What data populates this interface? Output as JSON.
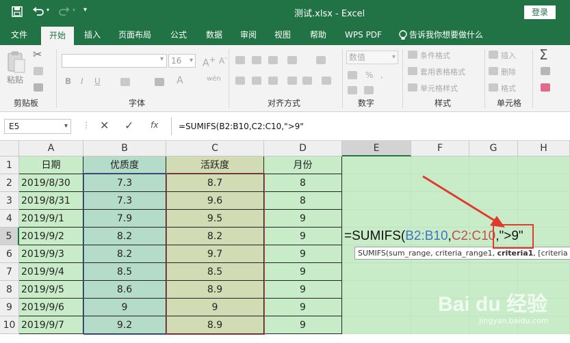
{
  "window": {
    "title": "测试.xlsx  -  Excel",
    "login_label": "登录"
  },
  "menu": [
    {
      "label": "文件",
      "active": false
    },
    {
      "label": "开始",
      "active": true
    },
    {
      "label": "插入",
      "active": false
    },
    {
      "label": "页面布局",
      "active": false
    },
    {
      "label": "公式",
      "active": false
    },
    {
      "label": "数据",
      "active": false
    },
    {
      "label": "审阅",
      "active": false
    },
    {
      "label": "视图",
      "active": false
    },
    {
      "label": "帮助",
      "active": false
    },
    {
      "label": "WPS PDF",
      "active": false
    }
  ],
  "tell_me": "告诉我你想要做什么",
  "ribbon": {
    "paste_label": "粘贴",
    "font_size": "16",
    "number_format": "数值",
    "conditional_format": "条件格式",
    "table_format": "套用表格格式",
    "cell_style": "单元格样式",
    "insert": "插入",
    "delete": "删除",
    "format": "格式",
    "groups": {
      "clipboard": "剪贴板",
      "font": "字体",
      "alignment": "对齐方式",
      "number": "数字",
      "styles": "样式",
      "cells": "单元格"
    }
  },
  "formula_bar": {
    "name_box": "E5",
    "fx": "fx",
    "formula": "=SUMIFS(B2:B10,C2:C10,\">9\""
  },
  "columns": [
    "A",
    "B",
    "C",
    "D",
    "E",
    "F",
    "G",
    "H"
  ],
  "rows": [
    "1",
    "2",
    "3",
    "4",
    "5",
    "6",
    "7",
    "8",
    "9",
    "10"
  ],
  "table": {
    "headers": [
      "日期",
      "优质度",
      "活跃度",
      "月份"
    ],
    "data": [
      [
        "2019/8/30",
        "7.3",
        "8.7",
        "8"
      ],
      [
        "2019/8/31",
        "7.3",
        "9.6",
        "8"
      ],
      [
        "2019/9/1",
        "7.9",
        "9.5",
        "9"
      ],
      [
        "2019/9/2",
        "8.2",
        "8.2",
        "9"
      ],
      [
        "2019/9/3",
        "8.2",
        "9.7",
        "9"
      ],
      [
        "2019/9/4",
        "8.5",
        "8.5",
        "9"
      ],
      [
        "2019/9/5",
        "8.6",
        "8.9",
        "9"
      ],
      [
        "2019/9/6",
        "9",
        "9",
        "9"
      ],
      [
        "2019/9/7",
        "9.2",
        "8.9",
        "9"
      ]
    ]
  },
  "edit_cell": {
    "prefix": "=SUMIFS(",
    "ref1": "B2:B10",
    "comma1": ",",
    "ref2": "C2:C10",
    "comma2": ",",
    "criteria": "\">9\""
  },
  "tooltip": {
    "prefix": "SUMIFS(sum_range, criteria_range1, ",
    "bold": "criteria1",
    "suffix": ", [criteria"
  },
  "watermark": {
    "brand": "Bai du 经验",
    "url": "jingyan.baidu.com"
  },
  "colors": {
    "excel_green": "#217346",
    "cell_fill": "#c8ecc8",
    "ref_blue": "#4472c4",
    "ref_red": "#c0504d",
    "annotation_red": "#e03a2f"
  }
}
